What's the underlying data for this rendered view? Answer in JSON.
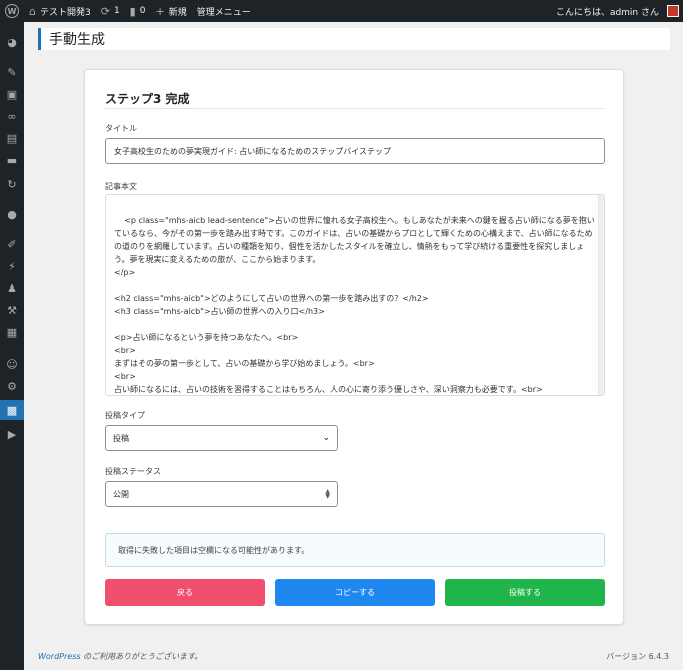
{
  "adminbar": {
    "site_name": "テスト開発3",
    "updates_count": "1",
    "comments_count": "0",
    "new_label": "新規",
    "admin_menu_label": "管理メニュー",
    "greeting": "こんにちは、admin さん"
  },
  "sidebar": {
    "icons": [
      "dashboard-icon",
      "pin-icon",
      "media-icon",
      "link-icon",
      "pages-icon",
      "comments-icon",
      "refresh-icon",
      "circle-icon",
      "brush-icon",
      "plugin-icon",
      "users-icon",
      "tools-icon",
      "settings-icon",
      "profile-icon",
      "wrench-icon",
      "plugin-active-icon",
      "play-icon"
    ]
  },
  "page": {
    "title": "手動生成"
  },
  "card": {
    "title": "ステップ3 完成",
    "title_label": "タイトル",
    "title_value": "女子高校生のための夢実現ガイド: 占い師になるためのステップバイステップ",
    "body_label": "記事本文",
    "body_value": "<p class=\"mhs-aicb lead-sentence\">占いの世界に憧れる女子高校生へ。もしあなたが未来への鍵を握る占い師になる夢を抱いているなら、今がその第一歩を踏み出す時です。このガイドは、占いの基礎からプロとして輝くための心構えまで、占い師になるための道のりを網羅しています。占いの種類を知り、個性を活かしたスタイルを確立し、情熱をもって学び続ける重要性を探究しましょう。夢を現実に変えるための旅が、ここから始まります。\n</p>\n\n<h2 class=\"mhs-aicb\">どのようにして占いの世界への第一歩を踏み出すの？</h2>\n<h3 class=\"mhs-aicb\">占い師の世界への入り口</h3>\n\n<p>占い師になるという夢を持つあなたへ。<br>\n<br>\nまずはその夢の第一歩として、占いの基礎から学び始めましょう。<br>\n<br>\n占い師になるには、占いの技術を習得することはもちろん、人の心に寄り添う優しさや、深い洞察力も必要です。<br>",
    "post_type_label": "投稿タイプ",
    "post_type_value": "投稿",
    "post_status_label": "投稿ステータス",
    "post_status_value": "公開",
    "notice": "取得に失敗した項目は空欄になる可能性があります。",
    "back_button": "戻る",
    "copy_button": "コピーする",
    "post_button": "投稿する"
  },
  "colors": {
    "back": "#f0506e",
    "copy": "#1e87f0",
    "post": "#20b54a",
    "accent": "#2271b1"
  },
  "footer": {
    "thanks_link": "WordPress",
    "thanks_text": " のご利用ありがとうございます。",
    "version": "バージョン 6.4.3"
  }
}
